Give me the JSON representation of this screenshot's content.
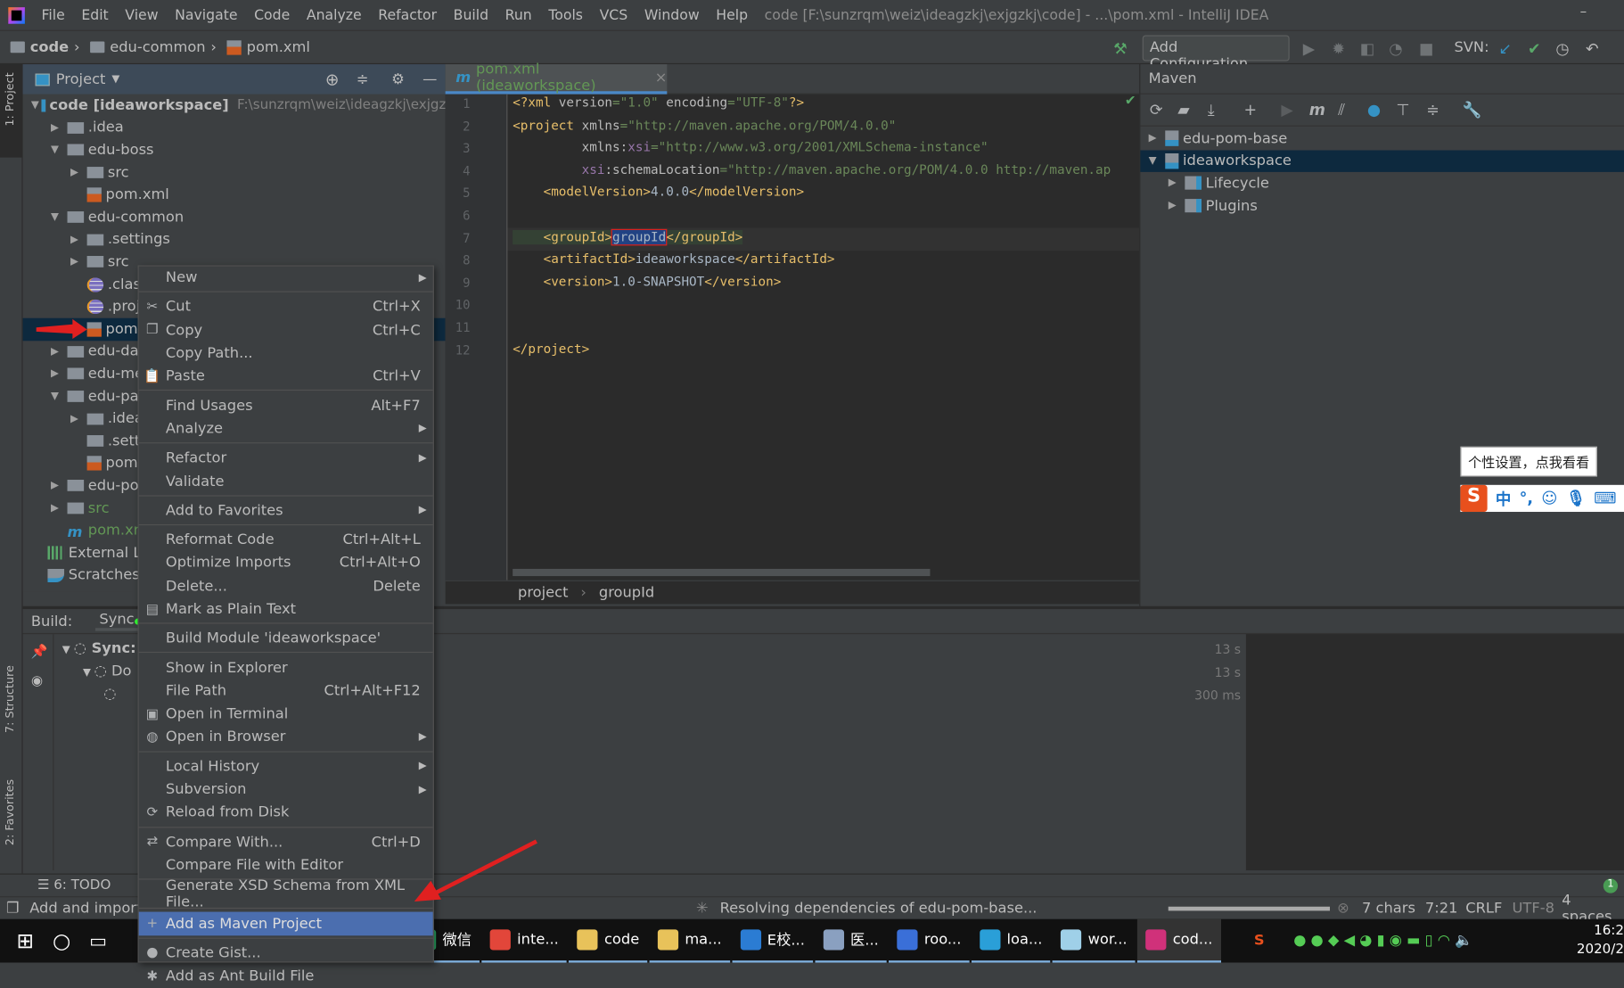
{
  "menubar": {
    "items": [
      "File",
      "Edit",
      "View",
      "Navigate",
      "Code",
      "Analyze",
      "Refactor",
      "Build",
      "Run",
      "Tools",
      "VCS",
      "Window",
      "Help"
    ],
    "title": "code [F:\\sunzrqm\\weiz\\ideagzkj\\exjgzkj\\code] - ...\\pom.xml - IntelliJ IDEA",
    "minimize": "–"
  },
  "navbar": {
    "crumbs": [
      "code",
      "edu-common",
      "pom.xml"
    ],
    "add_configuration": "Add Configuration...",
    "svn_label": "SVN:"
  },
  "stripe": {
    "project": "1: Project",
    "structure": "7: Structure",
    "favorites": "2: Favorites"
  },
  "project": {
    "title": "Project",
    "tree": [
      {
        "label": "code [ideaworkspace]",
        "path": "F:\\sunzrqm\\weiz\\ideagzkj\\exjgzkj\\c",
        "level": 0,
        "arrow": "open",
        "icon": "module-folder",
        "bold": true
      },
      {
        "label": ".idea",
        "level": 1,
        "arrow": "closed",
        "icon": "folder"
      },
      {
        "label": "edu-boss",
        "level": 1,
        "arrow": "open",
        "icon": "folder"
      },
      {
        "label": "src",
        "level": 2,
        "arrow": "closed",
        "icon": "folder"
      },
      {
        "label": "pom.xml",
        "level": 2,
        "arrow": "none",
        "icon": "xml-file"
      },
      {
        "label": "edu-common",
        "level": 1,
        "arrow": "open",
        "icon": "folder"
      },
      {
        "label": ".settings",
        "level": 2,
        "arrow": "closed",
        "icon": "folder"
      },
      {
        "label": "src",
        "level": 2,
        "arrow": "closed",
        "icon": "folder"
      },
      {
        "label": ".class",
        "level": 2,
        "arrow": "none",
        "icon": "eclipse-file"
      },
      {
        "label": ".proj",
        "level": 2,
        "arrow": "none",
        "icon": "eclipse-file"
      },
      {
        "label": "pom",
        "level": 2,
        "arrow": "none",
        "icon": "xml-file",
        "selected": true
      },
      {
        "label": "edu-dao",
        "level": 1,
        "arrow": "closed",
        "icon": "folder"
      },
      {
        "label": "edu-me",
        "level": 1,
        "arrow": "closed",
        "icon": "folder"
      },
      {
        "label": "edu-par",
        "level": 1,
        "arrow": "open",
        "icon": "folder"
      },
      {
        "label": ".idea",
        "level": 2,
        "arrow": "closed",
        "icon": "folder"
      },
      {
        "label": ".sett",
        "level": 2,
        "arrow": "none",
        "icon": "folder"
      },
      {
        "label": "pom",
        "level": 2,
        "arrow": "none",
        "icon": "xml-file"
      },
      {
        "label": "edu-po",
        "level": 1,
        "arrow": "closed",
        "icon": "folder"
      },
      {
        "label": "src",
        "level": 1,
        "arrow": "closed",
        "icon": "folder",
        "green": true
      },
      {
        "label": "pom.xml",
        "level": 1,
        "arrow": "none",
        "icon": "maven-file",
        "green": true
      },
      {
        "label": "External Lib",
        "level": 0,
        "arrow": "none",
        "icon": "library"
      },
      {
        "label": "Scratches a",
        "level": 0,
        "arrow": "none",
        "icon": "scratches"
      }
    ]
  },
  "editor": {
    "tab_label": "pom.xml (ideaworkspace)",
    "lines": [
      [
        [
          "<?xml ",
          "tag"
        ],
        [
          "version",
          "attr"
        ],
        [
          "=\"1.0\" ",
          "str"
        ],
        [
          "encoding",
          "attr"
        ],
        [
          "=\"UTF-8\"",
          "str"
        ],
        [
          "?>",
          "tag"
        ]
      ],
      [
        [
          "<project ",
          "tag"
        ],
        [
          "xmlns",
          "attr"
        ],
        [
          "=\"http://maven.apache.org/POM/4.0.0\"",
          "str"
        ]
      ],
      [
        [
          "         xmlns:",
          "attr"
        ],
        [
          "xsi",
          "ns"
        ],
        [
          "=\"http://www.w3.org/2001/XMLSchema-instance\"",
          "str"
        ]
      ],
      [
        [
          "         ",
          "attr"
        ],
        [
          "xsi",
          "ns"
        ],
        [
          ":schemaLocation",
          "attr"
        ],
        [
          "=\"http://maven.apache.org/POM/4.0.0 http://maven.ap",
          "str"
        ]
      ],
      [
        [
          "    <modelVersion>",
          "tag"
        ],
        [
          "4.0.0",
          "txt"
        ],
        [
          "</modelVersion>",
          "tag"
        ]
      ],
      [],
      [
        [
          "    <groupId>",
          "tag"
        ],
        [
          "groupId",
          "txt"
        ],
        [
          "</groupId>",
          "tag"
        ]
      ],
      [
        [
          "    <artifactId>",
          "tag"
        ],
        [
          "ideaworkspace",
          "txt"
        ],
        [
          "</artifactId>",
          "tag"
        ]
      ],
      [
        [
          "    <version>",
          "tag"
        ],
        [
          "1.0-SNAPSHOT",
          "txt"
        ],
        [
          "</version>",
          "tag"
        ]
      ],
      [],
      [],
      [
        [
          "</project>",
          "tag"
        ]
      ]
    ],
    "breadcrumb": [
      "project",
      "groupId"
    ]
  },
  "maven": {
    "title": "Maven",
    "tree": [
      {
        "label": "edu-pom-base",
        "level": 0,
        "arrow": "closed",
        "icon": "maven-module"
      },
      {
        "label": "ideaworkspace",
        "level": 0,
        "arrow": "open",
        "icon": "maven-module",
        "selected": true
      },
      {
        "label": "Lifecycle",
        "level": 1,
        "arrow": "closed",
        "icon": "settings-folder"
      },
      {
        "label": "Plugins",
        "level": 1,
        "arrow": "closed",
        "icon": "settings-folder"
      }
    ]
  },
  "build": {
    "label": "Build:",
    "tab": "Sync",
    "tree": [
      {
        "label": "Sync:",
        "bold": true
      },
      {
        "label": "Do"
      },
      {
        "label": ""
      }
    ],
    "times": [
      "13 s",
      "13 s",
      "300 ms"
    ]
  },
  "toolwindows": {
    "todo": "6: TODO"
  },
  "status": {
    "left": "Add and import",
    "progress_text": "Resolving dependencies of edu-pom-base...",
    "progress_percent": 100,
    "chars": "7 chars",
    "position": "7:21",
    "line_sep": "CRLF",
    "encoding": "UTF-8",
    "indent": "4 spaces",
    "notifications": "1"
  },
  "context_menu": {
    "items": [
      {
        "label": "New",
        "submenu": true
      },
      {
        "label": "Cut",
        "shortcut": "Ctrl+X",
        "icon": "✂",
        "icon_name": "scissors-icon",
        "sep": true
      },
      {
        "label": "Copy",
        "shortcut": "Ctrl+C",
        "icon": "❐",
        "icon_name": "copy-icon"
      },
      {
        "label": "Copy Path..."
      },
      {
        "label": "Paste",
        "shortcut": "Ctrl+V",
        "icon": "📋",
        "icon_name": "clipboard-icon"
      },
      {
        "label": "Find Usages",
        "shortcut": "Alt+F7",
        "sep": true
      },
      {
        "label": "Analyze",
        "submenu": true
      },
      {
        "label": "Refactor",
        "submenu": true,
        "sep": true
      },
      {
        "label": "Validate"
      },
      {
        "label": "Add to Favorites",
        "submenu": true,
        "sep": true
      },
      {
        "label": "Reformat Code",
        "shortcut": "Ctrl+Alt+L",
        "sep": true
      },
      {
        "label": "Optimize Imports",
        "shortcut": "Ctrl+Alt+O"
      },
      {
        "label": "Delete...",
        "shortcut": "Delete"
      },
      {
        "label": "Mark as Plain Text",
        "icon": "▤",
        "icon_name": "plain-text-icon"
      },
      {
        "label": "Build Module 'ideaworkspace'",
        "sep": true
      },
      {
        "label": "Show in Explorer",
        "sep": true
      },
      {
        "label": "File Path",
        "shortcut": "Ctrl+Alt+F12"
      },
      {
        "label": "Open in Terminal",
        "icon": "▣",
        "icon_name": "terminal-icon"
      },
      {
        "label": "Open in Browser",
        "submenu": true,
        "icon": "◍",
        "icon_name": "globe-icon"
      },
      {
        "label": "Local History",
        "submenu": true,
        "sep": true
      },
      {
        "label": "Subversion",
        "submenu": true
      },
      {
        "label": "Reload from Disk",
        "icon": "⟳",
        "icon_name": "reload-icon"
      },
      {
        "label": "Compare With...",
        "shortcut": "Ctrl+D",
        "icon": "⇄",
        "icon_name": "compare-icon",
        "sep": true
      },
      {
        "label": "Compare File with Editor"
      },
      {
        "label": "Generate XSD Schema from XML File...",
        "sep": true
      },
      {
        "label": "Add as Maven Project",
        "icon": "+",
        "icon_name": "plus-icon",
        "sep": true,
        "highlighted": true
      },
      {
        "label": "Create Gist...",
        "icon": "●",
        "icon_name": "github-icon",
        "sep": true
      },
      {
        "label": "Add as Ant Build File",
        "icon": "✱",
        "icon_name": "ant-icon"
      }
    ]
  },
  "ime": {
    "tooltip": "个性设置，点我看看",
    "logo": "S",
    "mode": "中",
    "punct": "°,"
  },
  "taskbar": {
    "items": [
      {
        "label": "微信",
        "color": "#2aae67"
      },
      {
        "label": "inte...",
        "color": "#e2463a"
      },
      {
        "label": "code",
        "color": "#e8c25a"
      },
      {
        "label": "ma...",
        "color": "#e8c25a"
      },
      {
        "label": "E校...",
        "color": "#2b7cd3"
      },
      {
        "label": "医...",
        "color": "#8aa0c0"
      },
      {
        "label": "roo...",
        "color": "#3a6fd8"
      },
      {
        "label": "loa...",
        "color": "#2a9fd8"
      },
      {
        "label": "wor...",
        "color": "#9fd0e8"
      },
      {
        "label": "cod...",
        "color": "#d0317a"
      }
    ],
    "time": "16:2",
    "date": "2020/2"
  },
  "colors": {
    "accent": "#4b6eaf",
    "selection": "#0d293e",
    "editor_bg": "#2b2b2b",
    "panel_bg": "#3c3f41"
  }
}
